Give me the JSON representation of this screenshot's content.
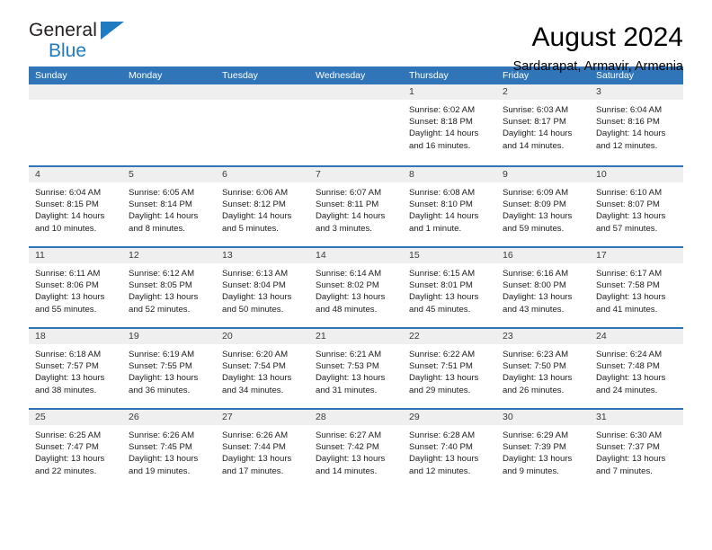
{
  "logo": {
    "word1": "General",
    "word2": "Blue",
    "triangle_color": "#1f7bc1"
  },
  "header": {
    "title": "August 2024",
    "subtitle": "Sardarapat, Armavir, Armenia"
  },
  "theme": {
    "header_blue": "#3075b8",
    "cell_num_bg": "#efefef",
    "logo_blue": "#1f7bc1"
  },
  "weekdays": [
    "Sunday",
    "Monday",
    "Tuesday",
    "Wednesday",
    "Thursday",
    "Friday",
    "Saturday"
  ],
  "weeks": [
    [
      {
        "day": "",
        "lines": []
      },
      {
        "day": "",
        "lines": []
      },
      {
        "day": "",
        "lines": []
      },
      {
        "day": "",
        "lines": []
      },
      {
        "day": "1",
        "lines": [
          "Sunrise: 6:02 AM",
          "Sunset: 8:18 PM",
          "Daylight: 14 hours",
          "and 16 minutes."
        ]
      },
      {
        "day": "2",
        "lines": [
          "Sunrise: 6:03 AM",
          "Sunset: 8:17 PM",
          "Daylight: 14 hours",
          "and 14 minutes."
        ]
      },
      {
        "day": "3",
        "lines": [
          "Sunrise: 6:04 AM",
          "Sunset: 8:16 PM",
          "Daylight: 14 hours",
          "and 12 minutes."
        ]
      }
    ],
    [
      {
        "day": "4",
        "lines": [
          "Sunrise: 6:04 AM",
          "Sunset: 8:15 PM",
          "Daylight: 14 hours",
          "and 10 minutes."
        ]
      },
      {
        "day": "5",
        "lines": [
          "Sunrise: 6:05 AM",
          "Sunset: 8:14 PM",
          "Daylight: 14 hours",
          "and 8 minutes."
        ]
      },
      {
        "day": "6",
        "lines": [
          "Sunrise: 6:06 AM",
          "Sunset: 8:12 PM",
          "Daylight: 14 hours",
          "and 5 minutes."
        ]
      },
      {
        "day": "7",
        "lines": [
          "Sunrise: 6:07 AM",
          "Sunset: 8:11 PM",
          "Daylight: 14 hours",
          "and 3 minutes."
        ]
      },
      {
        "day": "8",
        "lines": [
          "Sunrise: 6:08 AM",
          "Sunset: 8:10 PM",
          "Daylight: 14 hours",
          "and 1 minute."
        ]
      },
      {
        "day": "9",
        "lines": [
          "Sunrise: 6:09 AM",
          "Sunset: 8:09 PM",
          "Daylight: 13 hours",
          "and 59 minutes."
        ]
      },
      {
        "day": "10",
        "lines": [
          "Sunrise: 6:10 AM",
          "Sunset: 8:07 PM",
          "Daylight: 13 hours",
          "and 57 minutes."
        ]
      }
    ],
    [
      {
        "day": "11",
        "lines": [
          "Sunrise: 6:11 AM",
          "Sunset: 8:06 PM",
          "Daylight: 13 hours",
          "and 55 minutes."
        ]
      },
      {
        "day": "12",
        "lines": [
          "Sunrise: 6:12 AM",
          "Sunset: 8:05 PM",
          "Daylight: 13 hours",
          "and 52 minutes."
        ]
      },
      {
        "day": "13",
        "lines": [
          "Sunrise: 6:13 AM",
          "Sunset: 8:04 PM",
          "Daylight: 13 hours",
          "and 50 minutes."
        ]
      },
      {
        "day": "14",
        "lines": [
          "Sunrise: 6:14 AM",
          "Sunset: 8:02 PM",
          "Daylight: 13 hours",
          "and 48 minutes."
        ]
      },
      {
        "day": "15",
        "lines": [
          "Sunrise: 6:15 AM",
          "Sunset: 8:01 PM",
          "Daylight: 13 hours",
          "and 45 minutes."
        ]
      },
      {
        "day": "16",
        "lines": [
          "Sunrise: 6:16 AM",
          "Sunset: 8:00 PM",
          "Daylight: 13 hours",
          "and 43 minutes."
        ]
      },
      {
        "day": "17",
        "lines": [
          "Sunrise: 6:17 AM",
          "Sunset: 7:58 PM",
          "Daylight: 13 hours",
          "and 41 minutes."
        ]
      }
    ],
    [
      {
        "day": "18",
        "lines": [
          "Sunrise: 6:18 AM",
          "Sunset: 7:57 PM",
          "Daylight: 13 hours",
          "and 38 minutes."
        ]
      },
      {
        "day": "19",
        "lines": [
          "Sunrise: 6:19 AM",
          "Sunset: 7:55 PM",
          "Daylight: 13 hours",
          "and 36 minutes."
        ]
      },
      {
        "day": "20",
        "lines": [
          "Sunrise: 6:20 AM",
          "Sunset: 7:54 PM",
          "Daylight: 13 hours",
          "and 34 minutes."
        ]
      },
      {
        "day": "21",
        "lines": [
          "Sunrise: 6:21 AM",
          "Sunset: 7:53 PM",
          "Daylight: 13 hours",
          "and 31 minutes."
        ]
      },
      {
        "day": "22",
        "lines": [
          "Sunrise: 6:22 AM",
          "Sunset: 7:51 PM",
          "Daylight: 13 hours",
          "and 29 minutes."
        ]
      },
      {
        "day": "23",
        "lines": [
          "Sunrise: 6:23 AM",
          "Sunset: 7:50 PM",
          "Daylight: 13 hours",
          "and 26 minutes."
        ]
      },
      {
        "day": "24",
        "lines": [
          "Sunrise: 6:24 AM",
          "Sunset: 7:48 PM",
          "Daylight: 13 hours",
          "and 24 minutes."
        ]
      }
    ],
    [
      {
        "day": "25",
        "lines": [
          "Sunrise: 6:25 AM",
          "Sunset: 7:47 PM",
          "Daylight: 13 hours",
          "and 22 minutes."
        ]
      },
      {
        "day": "26",
        "lines": [
          "Sunrise: 6:26 AM",
          "Sunset: 7:45 PM",
          "Daylight: 13 hours",
          "and 19 minutes."
        ]
      },
      {
        "day": "27",
        "lines": [
          "Sunrise: 6:26 AM",
          "Sunset: 7:44 PM",
          "Daylight: 13 hours",
          "and 17 minutes."
        ]
      },
      {
        "day": "28",
        "lines": [
          "Sunrise: 6:27 AM",
          "Sunset: 7:42 PM",
          "Daylight: 13 hours",
          "and 14 minutes."
        ]
      },
      {
        "day": "29",
        "lines": [
          "Sunrise: 6:28 AM",
          "Sunset: 7:40 PM",
          "Daylight: 13 hours",
          "and 12 minutes."
        ]
      },
      {
        "day": "30",
        "lines": [
          "Sunrise: 6:29 AM",
          "Sunset: 7:39 PM",
          "Daylight: 13 hours",
          "and 9 minutes."
        ]
      },
      {
        "day": "31",
        "lines": [
          "Sunrise: 6:30 AM",
          "Sunset: 7:37 PM",
          "Daylight: 13 hours",
          "and 7 minutes."
        ]
      }
    ]
  ]
}
